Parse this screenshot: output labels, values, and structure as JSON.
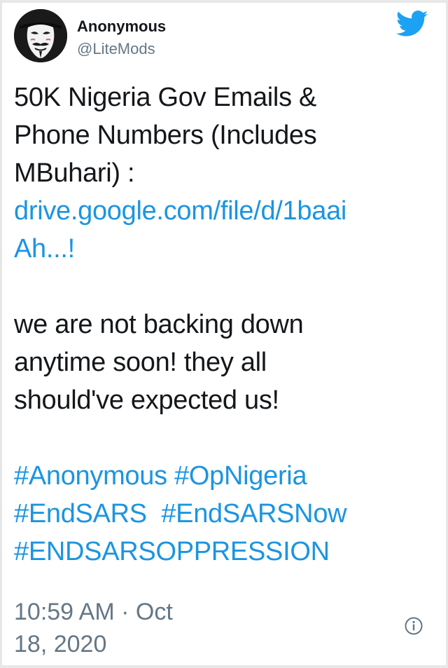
{
  "author": {
    "name": "Anonymous",
    "handle": "@LiteMods",
    "avatar_icon": "anonymous-mask-avatar"
  },
  "brand": {
    "logo_icon": "twitter-bird-icon",
    "logo_color": "#1da1f2"
  },
  "tweet": {
    "lines_intro": [
      "50K Nigeria Gov Emails &",
      "Phone Numbers (Includes",
      "MBuhari) :"
    ],
    "link_lines": [
      "drive.google.com/file/d/1baai",
      "Ah...!"
    ],
    "lines_message": [
      "we are not backing down",
      "anytime soon!  they all",
      "should've expected us!"
    ],
    "hashtag_lines": [
      [
        "#Anonymous",
        "#OpNigeria"
      ],
      [
        "#EndSARS",
        "#EndSARSNow"
      ],
      [
        "#ENDSARSOPPRESSION"
      ]
    ],
    "link_color": "#1b95e0"
  },
  "meta": {
    "time_line1": "10:59 AM · Oct",
    "time_line2": "18, 2020",
    "info_icon": "info-icon"
  }
}
